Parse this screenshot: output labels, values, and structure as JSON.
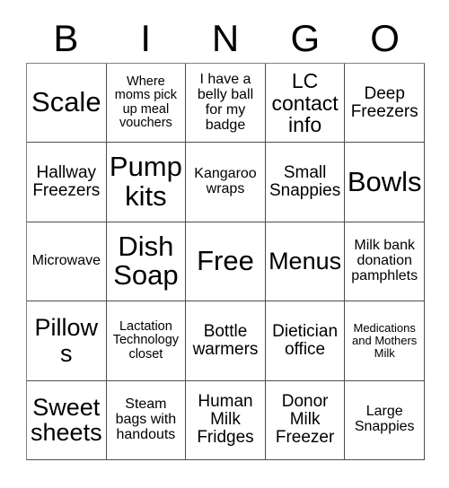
{
  "card": {
    "title_letters": [
      "B",
      "I",
      "N",
      "G",
      "O"
    ],
    "grid": {
      "columns": 5,
      "rows": 5,
      "free_space_label": "Free",
      "cells": [
        [
          {
            "label": "Scale",
            "size": "sz-xxl"
          },
          {
            "label": "Where moms pick up meal vouchers",
            "size": "sz-xs"
          },
          {
            "label": "I have a belly ball for my badge",
            "size": "sz-s"
          },
          {
            "label": "LC contact info",
            "size": "sz-l"
          },
          {
            "label": "Deep Freezers",
            "size": "sz-m"
          }
        ],
        [
          {
            "label": "Hallway Freezers",
            "size": "sz-m"
          },
          {
            "label": "Pump kits",
            "size": "sz-xxl"
          },
          {
            "label": "Kangaroo wraps",
            "size": "sz-s"
          },
          {
            "label": "Small Snappies",
            "size": "sz-m"
          },
          {
            "label": "Bowls",
            "size": "sz-xxl"
          }
        ],
        [
          {
            "label": "Microwave",
            "size": "sz-s"
          },
          {
            "label": "Dish Soap",
            "size": "sz-xxl"
          },
          {
            "label": "Free",
            "size": "sz-xxl"
          },
          {
            "label": "Menus",
            "size": "sz-xl"
          },
          {
            "label": "Milk bank donation pamphlets",
            "size": "sz-s"
          }
        ],
        [
          {
            "label": "Pillows",
            "size": "sz-xl"
          },
          {
            "label": "Lactation Technology closet",
            "size": "sz-xs"
          },
          {
            "label": "Bottle warmers",
            "size": "sz-m"
          },
          {
            "label": "Dietician office",
            "size": "sz-m"
          },
          {
            "label": "Medications and Mothers Milk",
            "size": "sz-xxs"
          }
        ],
        [
          {
            "label": "Sweet sheets",
            "size": "sz-xl"
          },
          {
            "label": "Steam bags with handouts",
            "size": "sz-s"
          },
          {
            "label": "Human Milk Fridges",
            "size": "sz-m"
          },
          {
            "label": "Donor Milk Freezer",
            "size": "sz-m"
          },
          {
            "label": "Large Snappies",
            "size": "sz-s"
          }
        ]
      ]
    },
    "colors": {
      "background": "#ffffff",
      "text": "#000000",
      "grid_line": "#4d4d4d"
    }
  }
}
